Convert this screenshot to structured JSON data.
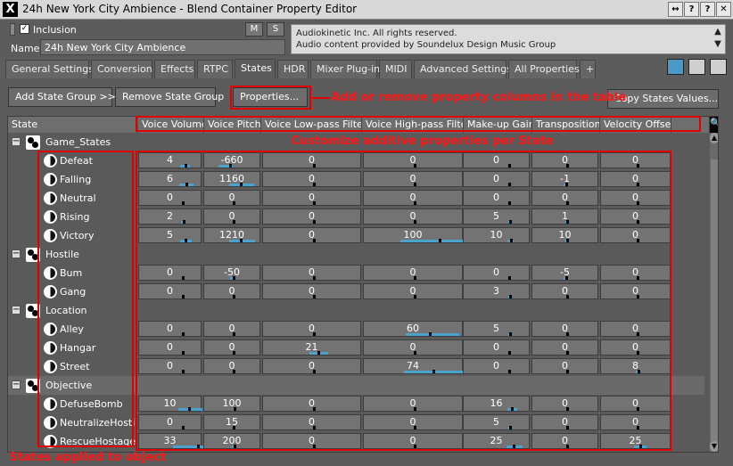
{
  "window": {
    "title": "24h New York City Ambience - Blend Container Property Editor",
    "buttons": [
      "↔",
      "?",
      "?",
      "✕"
    ]
  },
  "header": {
    "inclusion_label": "Inclusion",
    "m_label": "M",
    "s_label": "S",
    "name_label": "Name",
    "name_value": "24h New York City Ambience",
    "notes_line1": "Audiokinetic Inc. All rights reserved.",
    "notes_line2": "Audio content provided by Soundelux Design Music Group"
  },
  "tabs": [
    {
      "label": "General Settings",
      "active": false
    },
    {
      "label": "Conversion",
      "active": false
    },
    {
      "label": "Effects",
      "active": false
    },
    {
      "label": "RTPC",
      "active": false
    },
    {
      "label": "States",
      "active": true
    },
    {
      "label": "HDR",
      "active": false
    },
    {
      "label": "Mixer Plug-in",
      "active": false
    },
    {
      "label": "MIDI",
      "active": false
    },
    {
      "label": "Advanced Settings",
      "active": false
    },
    {
      "label": "All Properties",
      "active": false
    },
    {
      "label": "+",
      "active": false
    }
  ],
  "toolbar": {
    "add_state_group": "Add State Group >>",
    "remove_state_group": "Remove State Group",
    "properties": "Properties...",
    "copy_states_values": "Copy States Values..."
  },
  "annotations": {
    "columns_note": "Add or remove property columns in the table",
    "cells_note": "Customize additive properties per State",
    "states_note": "States applied to object"
  },
  "columns": {
    "state": "State",
    "props": [
      "Voice Volume",
      "Voice Pitch",
      "Voice Low-pass Filter",
      "Voice High-pass Filter",
      "Make-up Gain",
      "Transposition",
      "Velocity Offset"
    ]
  },
  "rows": [
    {
      "type": "group",
      "label": "Game_States",
      "dark": false
    },
    {
      "type": "state",
      "label": "Defeat",
      "values": [
        "4",
        "-660",
        "0",
        "0",
        "0",
        "0",
        "0"
      ]
    },
    {
      "type": "state",
      "label": "Falling",
      "values": [
        "6",
        "1160",
        "0",
        "0",
        "0",
        "-1",
        "0"
      ]
    },
    {
      "type": "state",
      "label": "Neutral",
      "values": [
        "0",
        "0",
        "0",
        "0",
        "0",
        "0",
        "0"
      ]
    },
    {
      "type": "state",
      "label": "Rising",
      "values": [
        "2",
        "0",
        "0",
        "0",
        "5",
        "1",
        "0"
      ]
    },
    {
      "type": "state",
      "label": "Victory",
      "values": [
        "5",
        "1210",
        "0",
        "100",
        "10",
        "10",
        "0"
      ]
    },
    {
      "type": "group",
      "label": "Hostile",
      "dark": false
    },
    {
      "type": "state",
      "label": "Bum",
      "values": [
        "0",
        "-50",
        "0",
        "0",
        "0",
        "-5",
        "0"
      ]
    },
    {
      "type": "state",
      "label": "Gang",
      "values": [
        "0",
        "0",
        "0",
        "0",
        "3",
        "0",
        "0"
      ]
    },
    {
      "type": "group",
      "label": "Location",
      "dark": false
    },
    {
      "type": "state",
      "label": "Alley",
      "values": [
        "0",
        "0",
        "0",
        "60",
        "5",
        "0",
        "0"
      ]
    },
    {
      "type": "state",
      "label": "Hangar",
      "values": [
        "0",
        "0",
        "21",
        "0",
        "0",
        "0",
        "0"
      ]
    },
    {
      "type": "state",
      "label": "Street",
      "values": [
        "0",
        "0",
        "0",
        "74",
        "0",
        "0",
        "8"
      ]
    },
    {
      "type": "group",
      "label": "Objective",
      "dark": true
    },
    {
      "type": "state",
      "label": "DefuseBomb",
      "values": [
        "10",
        "100",
        "0",
        "0",
        "16",
        "0",
        "0"
      ]
    },
    {
      "type": "state",
      "label": "NeutralizeHostile",
      "values": [
        "0",
        "15",
        "0",
        "0",
        "5",
        "0",
        "0"
      ]
    },
    {
      "type": "state",
      "label": "RescueHostage",
      "values": [
        "33",
        "200",
        "0",
        "0",
        "25",
        "0",
        "25"
      ]
    }
  ],
  "colors": {
    "annotation_red": "#e00000",
    "slider_blue": "#4aa3cf"
  }
}
